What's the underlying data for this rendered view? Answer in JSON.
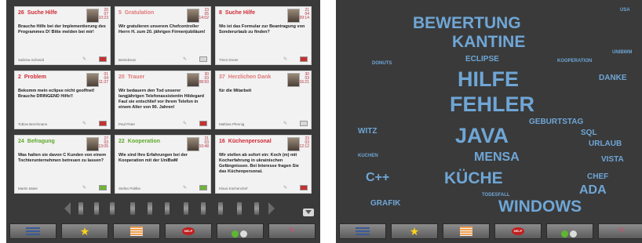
{
  "left_panel": {
    "cards": [
      {
        "num": "26",
        "title": "Suche Hilfe",
        "title_color": "red",
        "date_day": "20",
        "date_month": "07",
        "date_time": "10:23",
        "body": "Brauche Hilfe bei der Implementierung des Programmes D! Bitte melden bei mir!",
        "author": "Sabrina Schmidt",
        "flag": "red"
      },
      {
        "num": "5",
        "title": "Gratulation",
        "title_color": "pink",
        "date_day": "23",
        "date_month": "05",
        "date_time": "14:02",
        "body": "Wir gratulieren unserem Chefcontroller Herrn H. zum 20. jährigen Firmenjubiläum!",
        "author": "Betriebsrat",
        "flag": "none"
      },
      {
        "num": "8",
        "title": "Suche Hilfe",
        "title_color": "red",
        "date_day": "21",
        "date_month": "04",
        "date_time": "09:14",
        "body": "Wo ist das Formular zur Beantragung von Sonderurlaub zu finden?",
        "author": "Timm Dreier",
        "flag": "red"
      },
      {
        "num": "2",
        "title": "Problem",
        "title_color": "red",
        "date_day": "01",
        "date_month": "04",
        "date_time": "11:37",
        "body": "Bekomm mein eclipse nicht geoffnet! Brauche DRINGEND Hilfe!!",
        "author": "Tobias Berchmann",
        "flag": "red"
      },
      {
        "num": "20",
        "title": "Trauer",
        "title_color": "pink",
        "date_day": "30",
        "date_month": "03",
        "date_time": "08:50",
        "body": "Wir bedauern den Tod unserer langjährigen Telefonassistentin Hildegard Faul sie entschlief vor ihrem Telefon in einem Alter von 90. Jahren!",
        "author": "Paul Peter",
        "flag": "red"
      },
      {
        "num": "37",
        "title": "Herzlichen Dank",
        "title_color": "pink",
        "date_day": "30",
        "date_month": "03",
        "date_time": "16:21",
        "body": "für die Mitarbeit",
        "author": "Mathias Pfennig",
        "flag": "none"
      },
      {
        "num": "24",
        "title": "Befragung",
        "title_color": "green",
        "date_day": "27",
        "date_month": "03",
        "date_time": "13:05",
        "body": "Was halten sie davon C Kunden von einem Tochterunternehmen betreuen zu lassen?",
        "author": "Martin Maier",
        "flag": "green"
      },
      {
        "num": "22",
        "title": "Kooperation",
        "title_color": "green",
        "date_day": "21",
        "date_month": "03",
        "date_time": "10:48",
        "body": "Wie sind Ihre Erfahrungen bei der Kooperation mit der UniBwM",
        "author": "Stefan Pahlke",
        "flag": "green"
      },
      {
        "num": "16",
        "title": "Küchenpersonal",
        "title_color": "red",
        "date_day": "23",
        "date_month": "03",
        "date_time": "12:12",
        "body": "Wir stellen ab sofort ein: Koch (m) mit Kocherfahrung in ukrainischen Gefängnissen. Bei Interesse fragen Sie das Küchenpersonal.",
        "author": "Klaus Küchenchef",
        "flag": "red"
      }
    ]
  },
  "toolbar": {
    "buttons": [
      {
        "name": "list",
        "icon": "list-icon"
      },
      {
        "name": "favorites",
        "icon": "star-icon"
      },
      {
        "name": "stack",
        "icon": "stack-icon"
      },
      {
        "name": "help",
        "icon": "help-icon",
        "label": "HELP"
      },
      {
        "name": "vote",
        "icon": "thumbs-icon"
      },
      {
        "name": "write",
        "icon": "pen-icon"
      }
    ]
  },
  "word_cloud": {
    "words": [
      {
        "text": "BEWERTUNG",
        "size": "large"
      },
      {
        "text": "USA",
        "size": "tiny"
      },
      {
        "text": "KANTINE",
        "size": "large"
      },
      {
        "text": "UNIBWM",
        "size": "tiny"
      },
      {
        "text": "DONUTS",
        "size": "tiny"
      },
      {
        "text": "ECLIPSE",
        "size": "small"
      },
      {
        "text": "KOOPERATION",
        "size": "tiny"
      },
      {
        "text": "HILFE",
        "size": "xlarge"
      },
      {
        "text": "DANKE",
        "size": "small"
      },
      {
        "text": "FEHLER",
        "size": "xlarge"
      },
      {
        "text": "GEBURTSTAG",
        "size": "small"
      },
      {
        "text": "WITZ",
        "size": "small"
      },
      {
        "text": "JAVA",
        "size": "xlarge"
      },
      {
        "text": "SQL",
        "size": "small"
      },
      {
        "text": "URLAUB",
        "size": "small"
      },
      {
        "text": "KUCHEN",
        "size": "tiny"
      },
      {
        "text": "MENSA",
        "size": "medium"
      },
      {
        "text": "VISTA",
        "size": "small"
      },
      {
        "text": "C++",
        "size": "medium"
      },
      {
        "text": "KÜCHE",
        "size": "large"
      },
      {
        "text": "CHEF",
        "size": "small"
      },
      {
        "text": "ADA",
        "size": "medium"
      },
      {
        "text": "TODESFALL",
        "size": "tiny"
      },
      {
        "text": "GRAFIK",
        "size": "small"
      },
      {
        "text": "WINDOWS",
        "size": "large"
      }
    ]
  },
  "colors": {
    "panel_bg": "#3a3a3a",
    "card_bg": "#f2f2f2",
    "title_red": "#d02a35",
    "title_pink": "#e07878",
    "title_green": "#5ea82a",
    "cloud_blue": "#6fa6d6"
  }
}
